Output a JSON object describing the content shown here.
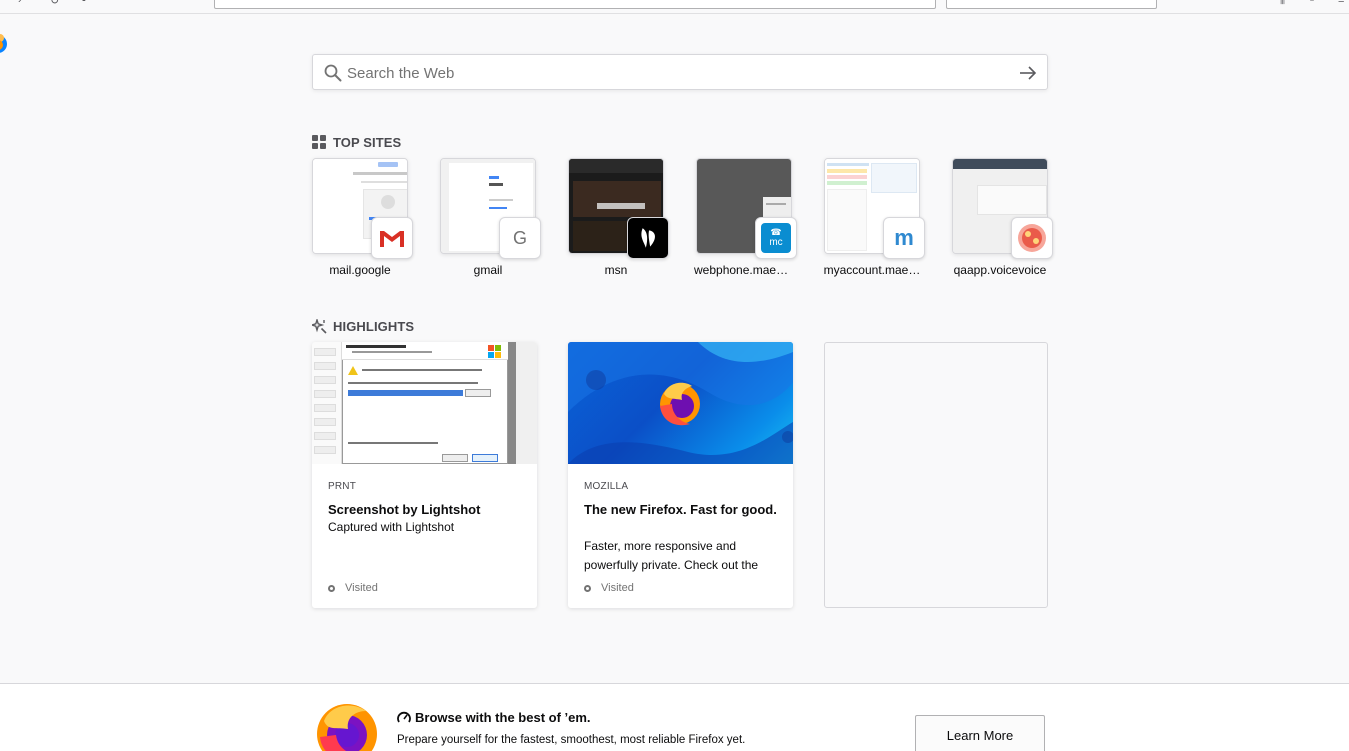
{
  "search": {
    "placeholder": "Search the Web"
  },
  "top_sites": {
    "title": "TOP SITES",
    "tiles": [
      {
        "label": "mail.google",
        "icon": "gmail-icon"
      },
      {
        "label": "gmail",
        "icon": "google-letter-icon",
        "badge_text": "G"
      },
      {
        "label": "msn",
        "icon": "msn-butterfly-icon"
      },
      {
        "label": "webphone.maes…",
        "icon": "mc-phone-icon",
        "badge_text": "mc"
      },
      {
        "label": "myaccount.mae…",
        "icon": "m-logo-icon",
        "badge_text": "m"
      },
      {
        "label": "qaapp.voicevoice",
        "icon": "voicevoice-icon"
      }
    ]
  },
  "highlights": {
    "title": "HIGHLIGHTS",
    "cards": [
      {
        "host": "PRNT",
        "title": "Screenshot by Lightshot",
        "description": "Captured with Lightshot",
        "context": "Visited"
      },
      {
        "host": "MOZILLA",
        "title": "The new Firefox. Fast for good.",
        "description": "Faster, more responsive and powerfully private. Check out the",
        "context": "Visited"
      }
    ]
  },
  "snippet": {
    "title": "Browse with the best of ’em.",
    "text": "Prepare yourself for the fastest, smoothest, most reliable Firefox yet.",
    "button": "Learn More"
  },
  "colors": {
    "background": "#f9f9fa",
    "firefox_orange": "#ff9400",
    "firefox_blue": "#0a84ff",
    "text_secondary": "#737373"
  }
}
